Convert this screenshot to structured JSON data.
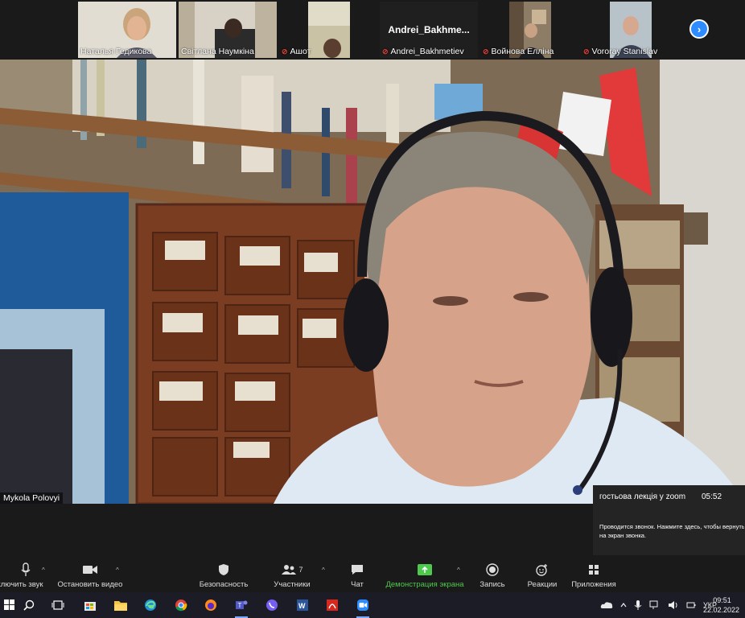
{
  "participants": [
    {
      "name": "Наталья Гедикова",
      "muted": false,
      "has_video": true
    },
    {
      "name": "Світлана Наумкіна",
      "muted": false,
      "has_video": true
    },
    {
      "name": "Ашот",
      "muted": true,
      "has_video": true
    },
    {
      "name": "Andrei_Bakhmetiev",
      "muted": true,
      "has_video": false,
      "display_label": "Andrei_Bakhme..."
    },
    {
      "name": "Войнова Елліна",
      "muted": true,
      "has_video": true
    },
    {
      "name": "Vororay Stanislav",
      "muted": true,
      "has_video": true
    }
  ],
  "speaker": {
    "name": "Mykola Polovyi"
  },
  "call_popup": {
    "title": "гостьова лекція у zoom",
    "time": "05:52",
    "message": "Проводится звонок. Нажмите здесь, чтобы вернуть\nна экран звонка."
  },
  "toolbar": {
    "audio_label": "ключить звук",
    "video_label": "Остановить видео",
    "security_label": "Безопасность",
    "participants_label": "Участники",
    "participants_count": "7",
    "chat_label": "Чат",
    "share_label": "Демонстрация экрана",
    "record_label": "Запись",
    "reactions_label": "Реакции",
    "apps_label": "Приложения"
  },
  "taskbar": {
    "language": "УКР",
    "time": "09:51",
    "date": "22.02.2022"
  },
  "colors": {
    "share_green": "#4ec94e",
    "mute_red": "#e0413a",
    "end_call_red": "#c4314b",
    "next_blue": "#2d8cff"
  }
}
